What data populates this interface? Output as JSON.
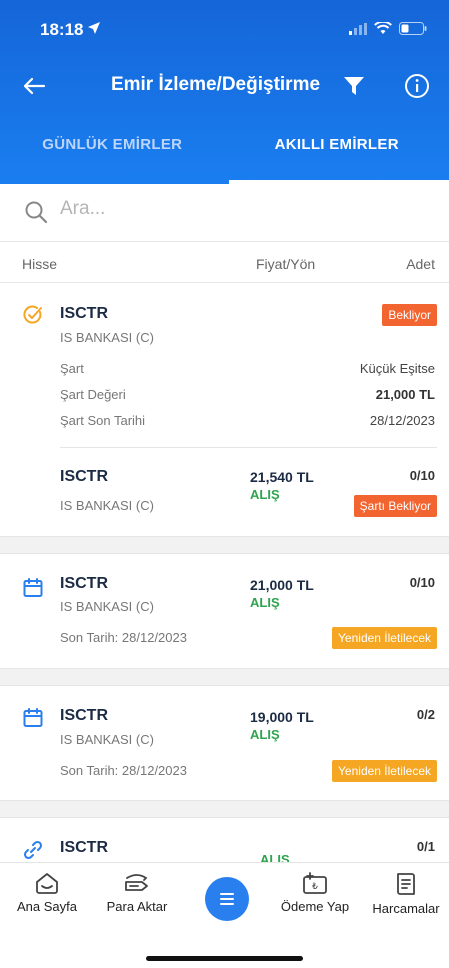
{
  "status_bar": {
    "time": "18:18"
  },
  "nav": {
    "title": "Emir İzleme/Değiştirme"
  },
  "tabs": [
    {
      "label": "GÜNLÜK EMİRLER",
      "active": false
    },
    {
      "label": "AKILLI EMİRLER",
      "active": true
    }
  ],
  "search": {
    "placeholder": "Ara..."
  },
  "columns": {
    "stock": "Hisse",
    "price_dir": "Fiyat/Yön",
    "qty": "Adet"
  },
  "condition_card": {
    "symbol": "ISCTR",
    "company": "IS BANKASI (C)",
    "status": "Bekliyor",
    "rows": [
      {
        "label": "Şart",
        "value": "Küçük Eşitse"
      },
      {
        "label": "Şart Değeri",
        "value": "21,000 TL"
      },
      {
        "label": "Şart Son Tarihi",
        "value": "28/12/2023"
      }
    ],
    "order": {
      "symbol": "ISCTR",
      "company": "IS BANKASI (C)",
      "price": "21,540 TL",
      "direction": "ALIŞ",
      "qty": "0/10",
      "status": "Şartı Bekliyor"
    }
  },
  "orders": [
    {
      "symbol": "ISCTR",
      "company": "IS BANKASI (C)",
      "price": "21,000 TL",
      "direction": "ALIŞ",
      "qty": "0/10",
      "deadline": "Son Tarih: 28/12/2023",
      "status": "Yeniden İletilecek"
    },
    {
      "symbol": "ISCTR",
      "company": "IS BANKASI (C)",
      "price": "19,000 TL",
      "direction": "ALIŞ",
      "qty": "0/2",
      "deadline": "Son Tarih: 28/12/2023",
      "status": "Yeniden İletilecek"
    },
    {
      "symbol": "ISCTR",
      "direction": "ALIŞ",
      "qty": "0/1"
    }
  ],
  "bottom_nav": [
    {
      "label": "Ana Sayfa",
      "icon": "home-icon"
    },
    {
      "label": "Para Aktar",
      "icon": "transfer-icon"
    },
    {
      "label": "",
      "icon": "menu-icon"
    },
    {
      "label": "Ödeme Yap",
      "icon": "payment-icon"
    },
    {
      "label": "Harcamalar",
      "icon": "receipt-icon"
    }
  ],
  "colors": {
    "primary": "#1a73e8",
    "buy": "#2ea44f",
    "badge_red": "#f26430",
    "badge_orange": "#f5a623",
    "condition_icon": "#f5a623"
  }
}
